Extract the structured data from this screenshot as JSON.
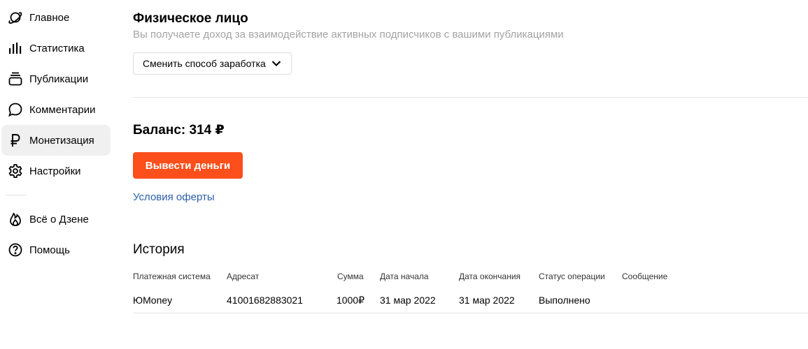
{
  "sidebar": {
    "items": [
      {
        "label": "Главное",
        "icon": "planet-icon"
      },
      {
        "label": "Статистика",
        "icon": "bar-chart-icon"
      },
      {
        "label": "Публикации",
        "icon": "stack-icon"
      },
      {
        "label": "Комментарии",
        "icon": "speech-bubble-icon"
      },
      {
        "label": "Монетизация",
        "icon": "ruble-icon",
        "active": true
      },
      {
        "label": "Настройки",
        "icon": "gear-icon"
      },
      {
        "label": "Всё о Дзене",
        "icon": "flame-icon"
      },
      {
        "label": "Помощь",
        "icon": "help-icon"
      }
    ]
  },
  "main": {
    "title": "Физическое лицо",
    "subtitle": "Вы получаете доход за взаимодействие активных подписчиков с вашими публикациями",
    "method_button_label": "Сменить способ заработка",
    "balance": "Баланс: 314 ₽",
    "withdraw_label": "Вывести деньги",
    "offer_link": "Условия оферты",
    "history_title": "История",
    "table": {
      "headers": [
        "Платежная система",
        "Адресат",
        "Сумма",
        "Дата начала",
        "Дата окончания",
        "Статус операции",
        "Сообщение"
      ],
      "rows": [
        [
          "ЮMoney",
          "41001682883021",
          "1000₽",
          "31 мар 2022",
          "31 мар 2022",
          "Выполнено",
          ""
        ]
      ]
    }
  },
  "colors": {
    "accent": "#fc4f1b",
    "link": "#2a5ea8",
    "muted_text": "#a3a3a3",
    "active_nav_bg": "#f0f0f0"
  }
}
